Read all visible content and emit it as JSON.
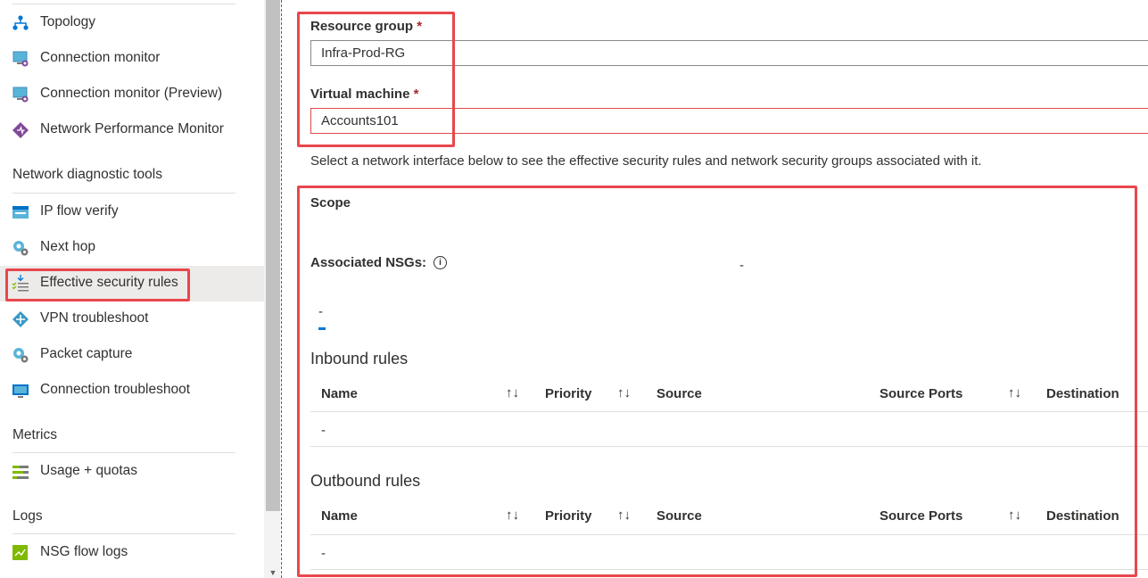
{
  "sidebar": {
    "items_top": [
      {
        "label": "Topology",
        "icon": "topology-icon"
      },
      {
        "label": "Connection monitor",
        "icon": "connection-monitor-icon"
      },
      {
        "label": "Connection monitor (Preview)",
        "icon": "connection-monitor-preview-icon"
      },
      {
        "label": "Network Performance Monitor",
        "icon": "network-performance-monitor-icon"
      }
    ],
    "section_diagnostic": "Network diagnostic tools",
    "items_diagnostic": [
      {
        "label": "IP flow verify",
        "icon": "ip-flow-verify-icon"
      },
      {
        "label": "Next hop",
        "icon": "next-hop-icon"
      },
      {
        "label": "Effective security rules",
        "icon": "effective-security-rules-icon"
      },
      {
        "label": "VPN troubleshoot",
        "icon": "vpn-troubleshoot-icon"
      },
      {
        "label": "Packet capture",
        "icon": "packet-capture-icon"
      },
      {
        "label": "Connection troubleshoot",
        "icon": "connection-troubleshoot-icon"
      }
    ],
    "section_metrics": "Metrics",
    "items_metrics": [
      {
        "label": "Usage + quotas",
        "icon": "usage-quotas-icon"
      }
    ],
    "section_logs": "Logs",
    "items_logs": [
      {
        "label": "NSG flow logs",
        "icon": "nsg-flow-logs-icon"
      }
    ]
  },
  "form": {
    "resource_group_label": "Resource group",
    "resource_group_value": "Infra-Prod-RG",
    "virtual_machine_label": "Virtual machine",
    "virtual_machine_value": "Accounts101",
    "required_mark": "*",
    "help_text": "Select a network interface below to see the effective security rules and network security groups associated with it."
  },
  "scope": {
    "label": "Scope",
    "associated_nsgs_label": "Associated NSGs:",
    "associated_nsgs_value": "-",
    "tab_label": "-"
  },
  "inbound": {
    "title": "Inbound rules",
    "columns": [
      "Name",
      "Priority",
      "Source",
      "Source Ports",
      "Destination"
    ],
    "rows": [
      "-"
    ]
  },
  "outbound": {
    "title": "Outbound rules",
    "columns": [
      "Name",
      "Priority",
      "Source",
      "Source Ports",
      "Destination"
    ],
    "rows": [
      "-"
    ]
  },
  "colors": {
    "highlight": "#e8474c",
    "accent": "#0078d4",
    "required": "#a4262c"
  }
}
